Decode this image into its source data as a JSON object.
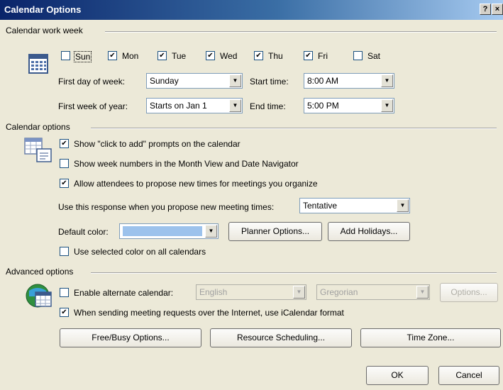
{
  "window": {
    "title": "Calendar Options",
    "help_glyph": "?",
    "close_glyph": "×"
  },
  "work_week": {
    "title": "Calendar work week",
    "days": [
      {
        "label": "Sun",
        "checked": false
      },
      {
        "label": "Mon",
        "checked": true
      },
      {
        "label": "Tue",
        "checked": true
      },
      {
        "label": "Wed",
        "checked": true
      },
      {
        "label": "Thu",
        "checked": true
      },
      {
        "label": "Fri",
        "checked": true
      },
      {
        "label": "Sat",
        "checked": false
      }
    ],
    "first_day_label": "First day of week:",
    "first_day_value": "Sunday",
    "first_week_label": "First week of year:",
    "first_week_value": "Starts on Jan 1",
    "start_time_label": "Start time:",
    "start_time_value": "8:00 AM",
    "end_time_label": "End time:",
    "end_time_value": "5:00 PM"
  },
  "calendar_options": {
    "title": "Calendar options",
    "show_click_to_add": {
      "label": "Show \"click to add\" prompts on the calendar",
      "checked": true
    },
    "show_week_numbers": {
      "label": "Show week numbers in the Month View and Date Navigator",
      "checked": false
    },
    "allow_attendees": {
      "label": "Allow attendees to propose new times for meetings you organize",
      "checked": true
    },
    "response_label": "Use this response when you propose new meeting times:",
    "response_value": "Tentative",
    "default_color_label": "Default color:",
    "default_color": "#9cc2ec",
    "planner_button": "Planner Options...",
    "holidays_button": "Add Holidays...",
    "use_selected_color": {
      "label": "Use selected color on all calendars",
      "checked": false
    }
  },
  "advanced": {
    "title": "Advanced options",
    "alternate_calendar": {
      "label": "Enable alternate calendar:",
      "checked": false
    },
    "alt_language": "English",
    "alt_type": "Gregorian",
    "options_button": "Options...",
    "icalendar": {
      "label": "When sending meeting requests over the Internet, use iCalendar format",
      "checked": true
    },
    "free_busy_button": "Free/Busy Options...",
    "resource_button": "Resource Scheduling...",
    "time_zone_button": "Time Zone..."
  },
  "footer": {
    "ok": "OK",
    "cancel": "Cancel"
  }
}
